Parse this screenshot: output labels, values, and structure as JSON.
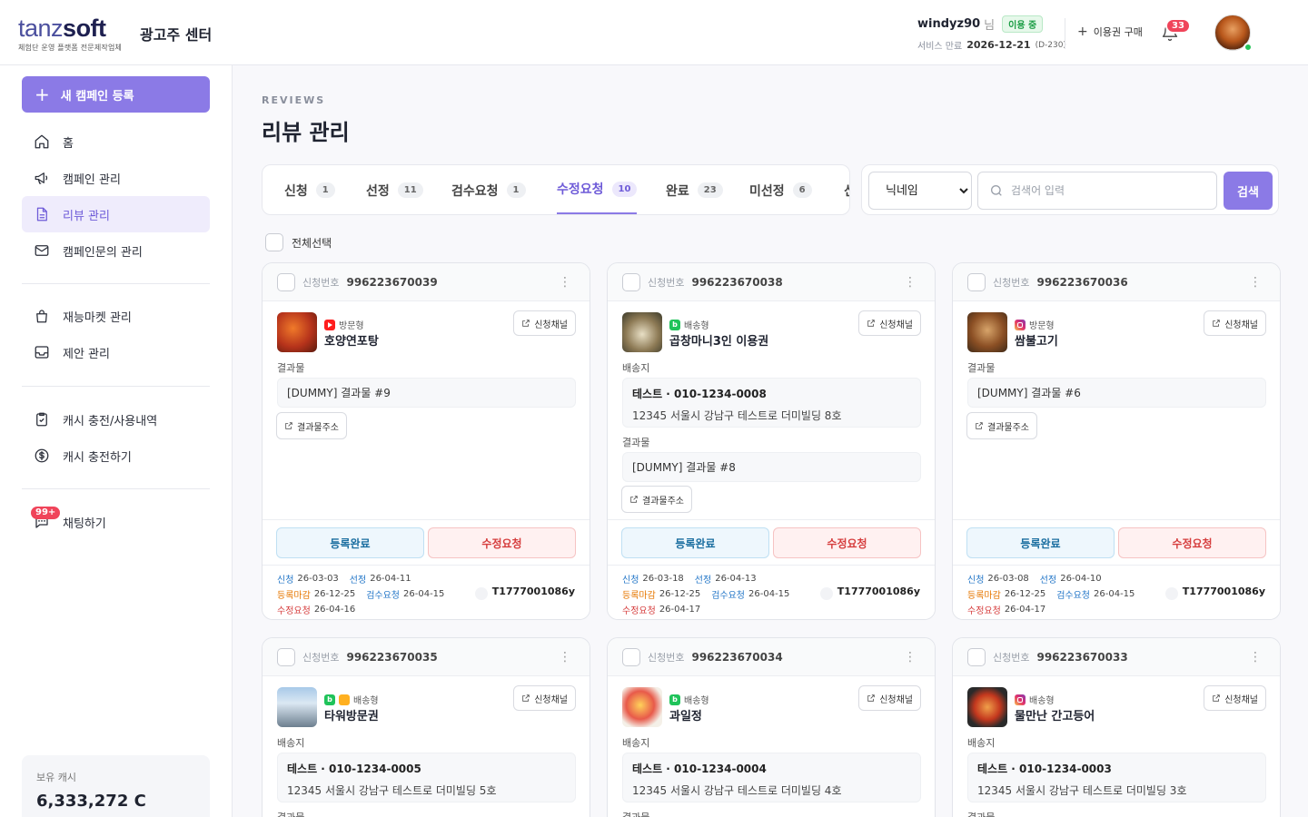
{
  "header": {
    "logo_light": "tanz",
    "logo_bold": "soft",
    "logo_sub": "체험단 운영 플랫폼 전문제작업체",
    "center_name": "광고주 센터",
    "user_id": "windyz90",
    "user_suffix": "님",
    "status_badge": "이용 중",
    "service_label": "서비스 만료",
    "service_date": "2026-12-21",
    "service_dday": "(D-230)",
    "buy_label": "이용권 구매",
    "notification_count": "33",
    "accent_color": "#8b7ae6"
  },
  "sidebar": {
    "new_campaign": "새 캠페인 등록",
    "items": [
      {
        "label": "홈",
        "icon": "home-icon"
      },
      {
        "label": "캠페인 관리",
        "icon": "megaphone-icon"
      },
      {
        "label": "리뷰 관리",
        "icon": "document-icon",
        "active": true
      },
      {
        "label": "캠페인문의 관리",
        "icon": "mail-icon"
      },
      {
        "label": "재능마켓 관리",
        "icon": "shopping-bag-icon"
      },
      {
        "label": "제안 관리",
        "icon": "inbox-icon"
      },
      {
        "label": "캐시 충전/사용내역",
        "icon": "clipboard-check-icon"
      },
      {
        "label": "캐시 충전하기",
        "icon": "dollar-icon"
      },
      {
        "label": "채팅하기",
        "icon": "chat-icon"
      }
    ],
    "chat_badge": "99+",
    "cash_label": "보유 캐시",
    "cash_value": "6,333,272 C"
  },
  "main": {
    "eyebrow": "REVIEWS",
    "title": "리뷰 관리",
    "tabs": [
      {
        "label": "신청",
        "count": "1"
      },
      {
        "label": "선정",
        "count": "11"
      },
      {
        "label": "검수요청",
        "count": "1"
      },
      {
        "label": "수정요청",
        "count": "10"
      },
      {
        "label": "완료",
        "count": "23"
      },
      {
        "label": "미선정",
        "count": "6"
      },
      {
        "label": "신",
        "count": ""
      }
    ],
    "search_select": "닉네임",
    "search_placeholder": "검색어 입력",
    "search_button": "검색",
    "select_all": "전체선택"
  },
  "labels": {
    "app_no": "신청번호",
    "channel": "신청채널",
    "result": "결과물",
    "shipping": "배송지",
    "result_link": "결과물주소",
    "done": "등록완료",
    "fix": "수정요청",
    "apply": "신청",
    "select": "선정",
    "reg_deadline": "등록마감",
    "inspect": "검수요청",
    "fix_req": "수정요청"
  },
  "cards": [
    {
      "app_no": "996223670039",
      "type": "방문형",
      "store": "호양연포탕",
      "result": "[DUMMY] 결과물 #9",
      "apply": "26-03-03",
      "select": "26-04-11",
      "deadline": "26-12-25",
      "inspect": "26-04-15",
      "fix": "26-04-16",
      "code": "T1777001086y"
    },
    {
      "app_no": "996223670038",
      "type": "배송형",
      "store": "곱창마니3인 이용권",
      "ship_name": "테스트 · 010-1234-0008",
      "ship_addr": "12345 서울시 강남구 테스트로 더미빌딩 8호",
      "result": "[DUMMY] 결과물 #8",
      "apply": "26-03-18",
      "select": "26-04-13",
      "deadline": "26-12-25",
      "inspect": "26-04-15",
      "fix": "26-04-17",
      "code": "T1777001086y"
    },
    {
      "app_no": "996223670036",
      "type": "방문형",
      "store": "쌈불고기",
      "result": "[DUMMY] 결과물 #6",
      "apply": "26-03-08",
      "select": "26-04-10",
      "deadline": "26-12-25",
      "inspect": "26-04-15",
      "fix": "26-04-17",
      "code": "T1777001086y"
    },
    {
      "app_no": "996223670035",
      "type": "배송형",
      "store": "타워방문권",
      "ship_name": "테스트 · 010-1234-0005",
      "ship_addr": "12345 서울시 강남구 테스트로 더미빌딩 5호",
      "result_label_partial": "결과물"
    },
    {
      "app_no": "996223670034",
      "type": "배송형",
      "store": "과일정",
      "ship_name": "테스트 · 010-1234-0004",
      "ship_addr": "12345 서울시 강남구 테스트로 더미빌딩 4호",
      "result_label_partial": "결과물"
    },
    {
      "app_no": "996223670033",
      "type": "배송형",
      "store": "물만난 간고등어",
      "ship_name": "테스트 · 010-1234-0003",
      "ship_addr": "12345 서울시 강남구 테스트로 더미빌딩 3호",
      "result_label_partial": "결과물"
    }
  ]
}
